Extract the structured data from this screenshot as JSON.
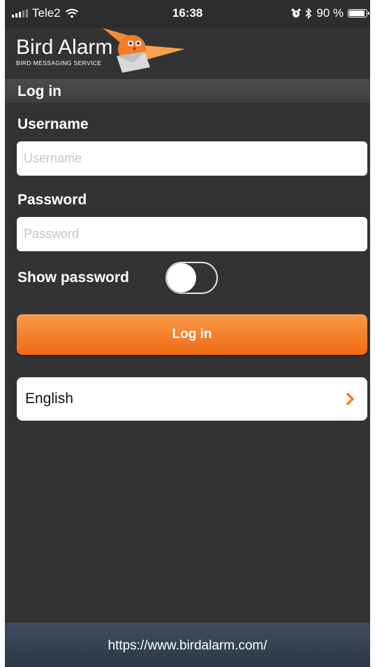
{
  "status_bar": {
    "carrier": "Tele2",
    "time": "16:38",
    "battery": "90 %",
    "battery_level": 0.9
  },
  "brand": {
    "name": "Bird Alarm",
    "tagline": "BIRD MESSAGING SERVICE"
  },
  "section_title": "Log in",
  "form": {
    "username_label": "Username",
    "username_placeholder": "Username",
    "username_value": "",
    "password_label": "Password",
    "password_placeholder": "Password",
    "password_value": "",
    "show_password_label": "Show password",
    "show_password_on": false,
    "login_button": "Log in"
  },
  "language": {
    "selected": "English"
  },
  "footer": {
    "url": "https://www.birdalarm.com/"
  },
  "colors": {
    "accent": "#f57b26",
    "background": "#333335"
  }
}
